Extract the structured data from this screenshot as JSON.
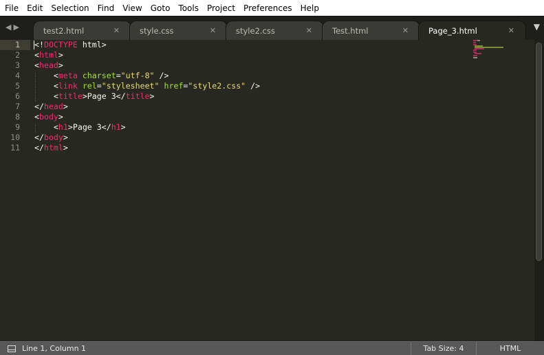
{
  "menu": [
    "File",
    "Edit",
    "Selection",
    "Find",
    "View",
    "Goto",
    "Tools",
    "Project",
    "Preferences",
    "Help"
  ],
  "tabs": [
    {
      "label": "test2.html",
      "active": false
    },
    {
      "label": "style.css",
      "active": false
    },
    {
      "label": "style2.css",
      "active": false
    },
    {
      "label": "Test.html",
      "active": false
    },
    {
      "label": "Page_3.html",
      "active": true
    }
  ],
  "editor": {
    "current_line": 1,
    "lines": [
      [
        [
          "<!",
          "p"
        ],
        [
          "DOCTYPE",
          "k"
        ],
        [
          " html>",
          "p"
        ]
      ],
      [
        [
          "<",
          "p"
        ],
        [
          "html",
          "k"
        ],
        [
          ">",
          "p"
        ]
      ],
      [
        [
          "<",
          "p"
        ],
        [
          "head",
          "k"
        ],
        [
          ">",
          "p"
        ]
      ],
      [
        [
          "    <",
          "p"
        ],
        [
          "meta",
          "k"
        ],
        [
          " ",
          "p"
        ],
        [
          "charset",
          "a"
        ],
        [
          "=",
          "p"
        ],
        [
          "\"utf-8\"",
          "s"
        ],
        [
          " />",
          "p"
        ]
      ],
      [
        [
          "    <",
          "p"
        ],
        [
          "link",
          "k"
        ],
        [
          " ",
          "p"
        ],
        [
          "rel",
          "a"
        ],
        [
          "=",
          "p"
        ],
        [
          "\"stylesheet\"",
          "s"
        ],
        [
          " ",
          "p"
        ],
        [
          "href",
          "a"
        ],
        [
          "=",
          "p"
        ],
        [
          "\"style2.css\"",
          "s"
        ],
        [
          " />",
          "p"
        ]
      ],
      [
        [
          "    <",
          "p"
        ],
        [
          "title",
          "k"
        ],
        [
          ">Page 3</",
          "p"
        ],
        [
          "title",
          "k"
        ],
        [
          ">",
          "p"
        ]
      ],
      [
        [
          "</",
          "p"
        ],
        [
          "head",
          "k"
        ],
        [
          ">",
          "p"
        ]
      ],
      [
        [
          "<",
          "p"
        ],
        [
          "body",
          "k"
        ],
        [
          ">",
          "p"
        ]
      ],
      [
        [
          "    <",
          "p"
        ],
        [
          "h1",
          "k"
        ],
        [
          ">Page 3</",
          "p"
        ],
        [
          "h1",
          "k"
        ],
        [
          ">",
          "p"
        ]
      ],
      [
        [
          "</",
          "p"
        ],
        [
          "body",
          "k"
        ],
        [
          ">",
          "p"
        ]
      ],
      [
        [
          "</",
          "p"
        ],
        [
          "html",
          "k"
        ],
        [
          ">",
          "p"
        ]
      ]
    ]
  },
  "status": {
    "position": "Line 1, Column 1",
    "tab_size": "Tab Size: 4",
    "syntax": "HTML"
  },
  "colors": {
    "background": "#272822",
    "tag": "#f92672",
    "attribute": "#a6e22e",
    "string": "#e6db74"
  }
}
